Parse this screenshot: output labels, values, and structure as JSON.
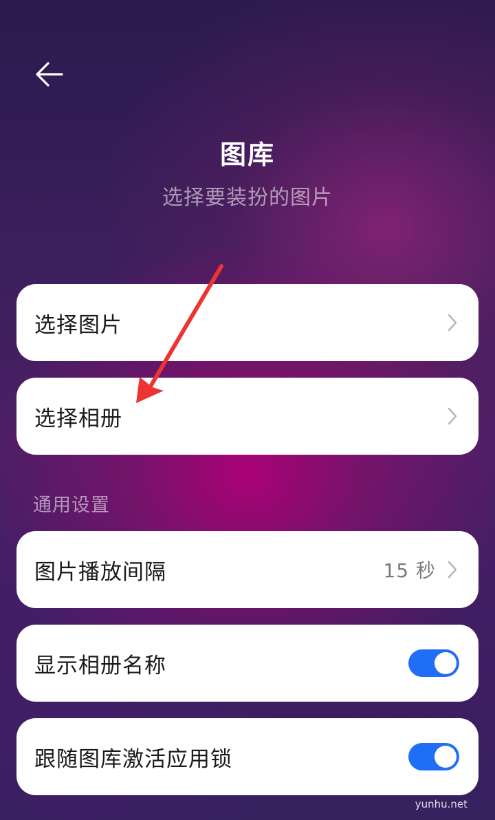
{
  "header": {
    "title": "图库",
    "subtitle": "选择要装扮的图片"
  },
  "icons": {
    "back": "arrow-left-icon",
    "chevron": "chevron-right-icon"
  },
  "menu": {
    "select_image": "选择图片",
    "select_album": "选择相册"
  },
  "general": {
    "section_title": "通用设置",
    "interval_label": "图片播放间隔",
    "interval_value": "15 秒",
    "show_album_name_label": "显示相册名称",
    "show_album_name_on": true,
    "app_lock_label": "跟随图库激活应用锁",
    "app_lock_on": true
  },
  "colors": {
    "toggle_on": "#1f6ef5",
    "annotation_arrow": "#ee3333"
  },
  "watermark": "yunhu.net"
}
